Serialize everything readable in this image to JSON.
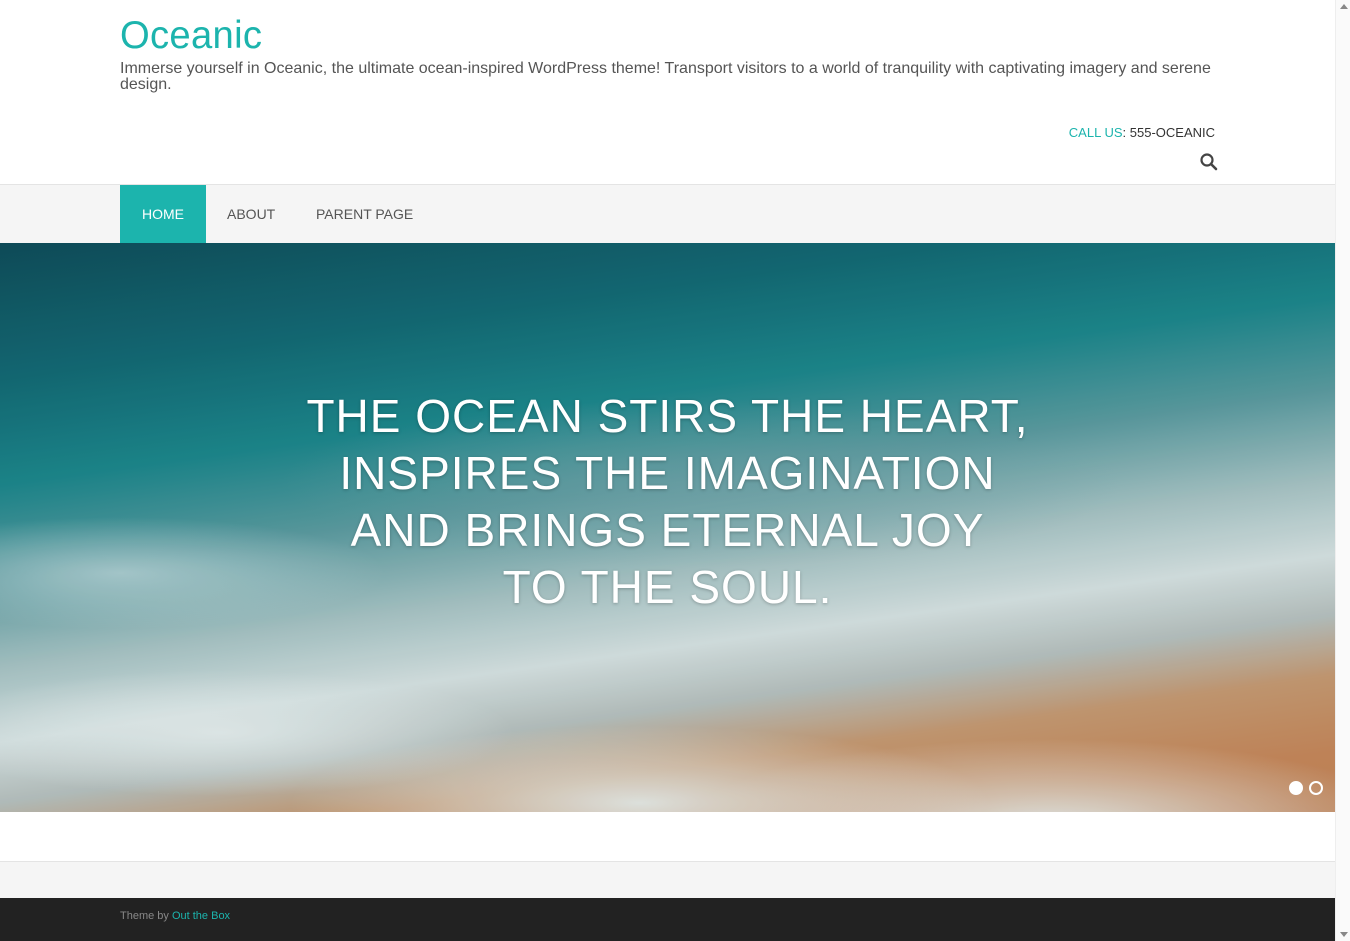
{
  "site": {
    "title": "Oceanic",
    "tagline": "Immerse yourself in Oceanic, the ultimate ocean-inspired WordPress theme! Transport visitors to a world of tranquility with captivating imagery and serene design.",
    "accent_color": "#1cb4ad"
  },
  "header": {
    "call_label": "CALL US",
    "call_separator": ": ",
    "call_number": "555-OCEANIC",
    "search_icon": "search-icon"
  },
  "nav": {
    "items": [
      {
        "label": "HOME",
        "active": true
      },
      {
        "label": "ABOUT",
        "active": false
      },
      {
        "label": "PARENT PAGE",
        "active": false
      }
    ]
  },
  "hero": {
    "caption": "THE OCEAN STIRS THE HEART,\nINSPIRES THE IMAGINATION\nAND BRINGS ETERNAL JOY\nTO THE SOUL.",
    "slides_total": 2,
    "active_slide": 1
  },
  "footer": {
    "prefix": "Theme by ",
    "link_text": "Out the Box",
    "background": "#222222"
  }
}
